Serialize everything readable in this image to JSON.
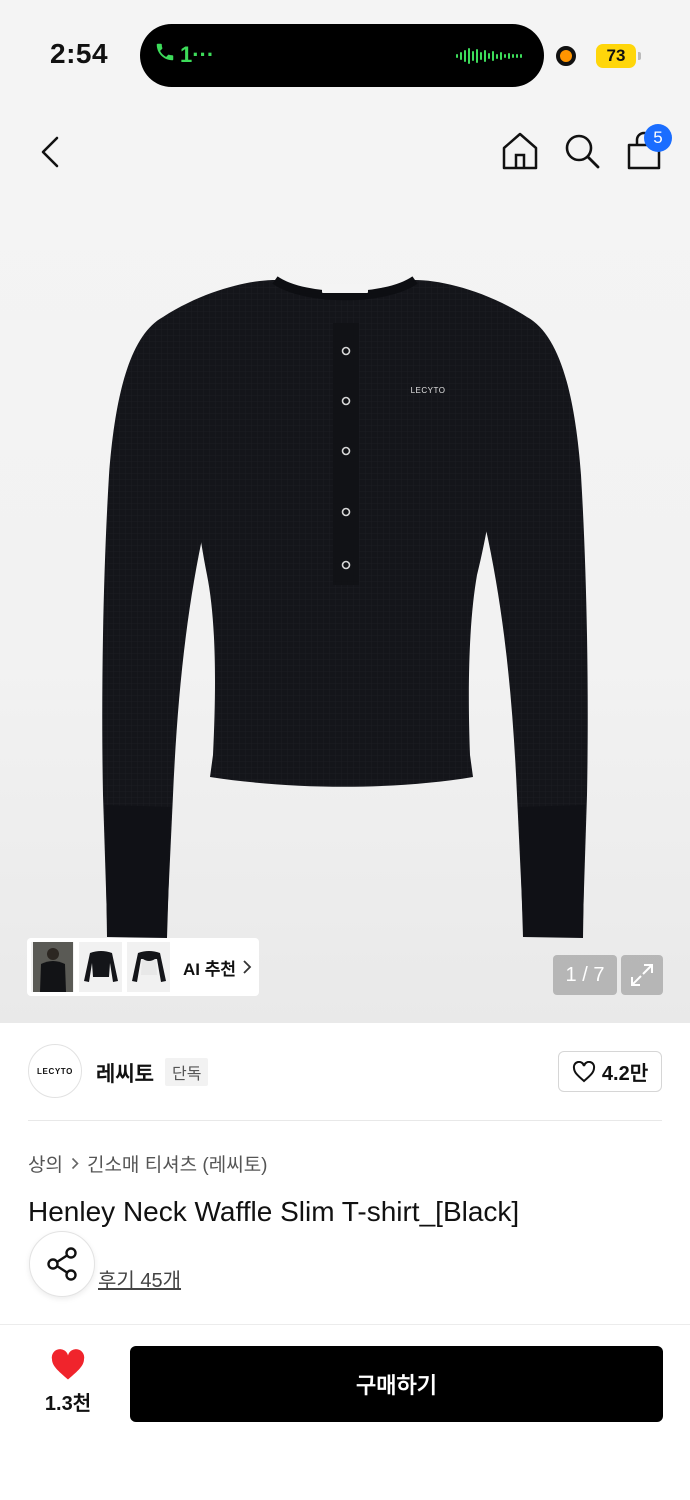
{
  "status_bar": {
    "time": "2:54",
    "call_indicator": "1···",
    "battery": "73",
    "icons": [
      "phone-icon",
      "waveform-icon",
      "recording-dot",
      "battery-icon"
    ],
    "colors": {
      "call_green": "#3ddc5a",
      "battery_yellow": "#ffd60a",
      "recording_orange": "#ff9500"
    }
  },
  "nav": {
    "icons": [
      "back-arrow-icon",
      "home-icon",
      "search-icon",
      "shopping-bag-icon"
    ],
    "cart_count": "5",
    "badge_color": "#1a6dff"
  },
  "gallery": {
    "shirt_logo": "LECYTO",
    "ai_recommend_label": "AI 추천",
    "counter": "1 / 7",
    "icons": [
      "chevron-right-icon",
      "expand-icon"
    ]
  },
  "brand": {
    "logo_text": "LECYTO",
    "name": "레씨토",
    "tag": "단독",
    "likes": "4.2만"
  },
  "product": {
    "breadcrumb": [
      "상의",
      "긴소매 티셔츠 (레씨토)"
    ],
    "title": "Henley Neck Waffle Slim T-shirt_[Black]",
    "reviews": "후기 45개"
  },
  "bottom_bar": {
    "wish_count": "1.3천",
    "buy_label": "구매하기",
    "wish_color": "#f0242c"
  }
}
